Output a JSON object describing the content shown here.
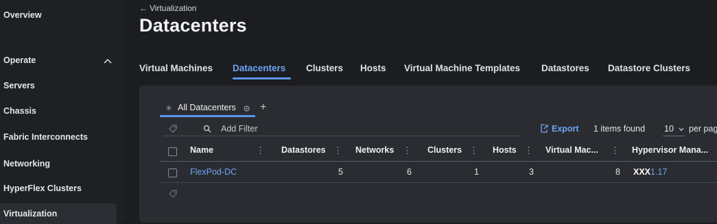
{
  "sidebar": {
    "items": [
      {
        "label": "Overview"
      },
      {
        "label": "Operate"
      },
      {
        "label": "Servers"
      },
      {
        "label": "Chassis"
      },
      {
        "label": "Fabric Interconnects"
      },
      {
        "label": "Networking"
      },
      {
        "label": "HyperFlex Clusters"
      },
      {
        "label": "Virtualization"
      }
    ],
    "selected": "Virtualization"
  },
  "header": {
    "back_label": "Virtualization",
    "title": "Datacenters"
  },
  "tabs": [
    {
      "label": "Virtual Machines"
    },
    {
      "label": "Datacenters",
      "active": true
    },
    {
      "label": "Clusters"
    },
    {
      "label": "Hosts"
    },
    {
      "label": "Virtual Machine Templates"
    },
    {
      "label": "Datastores"
    },
    {
      "label": "Datastore Clusters"
    }
  ],
  "table_view": {
    "view_tab_label": "All Datacenters",
    "filter_placeholder": "Add Filter",
    "export_label": "Export",
    "items_found": "1 items found",
    "page_size": "10",
    "per_page_label": "per pag"
  },
  "table": {
    "columns": [
      "Name",
      "Datastores",
      "Networks",
      "Clusters",
      "Hosts",
      "Virtual Mac...",
      "Hypervisor Mana..."
    ],
    "rows": [
      {
        "name": "FlexPod-DC",
        "datastores": "5",
        "networks": "6",
        "clusters": "1",
        "hosts": "3",
        "virtual_machines": "8",
        "hypervisor_prefix": "XXX",
        "hypervisor_suffix": "1.17"
      }
    ]
  },
  "colors": {
    "background": "#1b1d21",
    "panel": "#2a2c31",
    "accent": "#5a95ec",
    "link": "#6ea4f2"
  }
}
